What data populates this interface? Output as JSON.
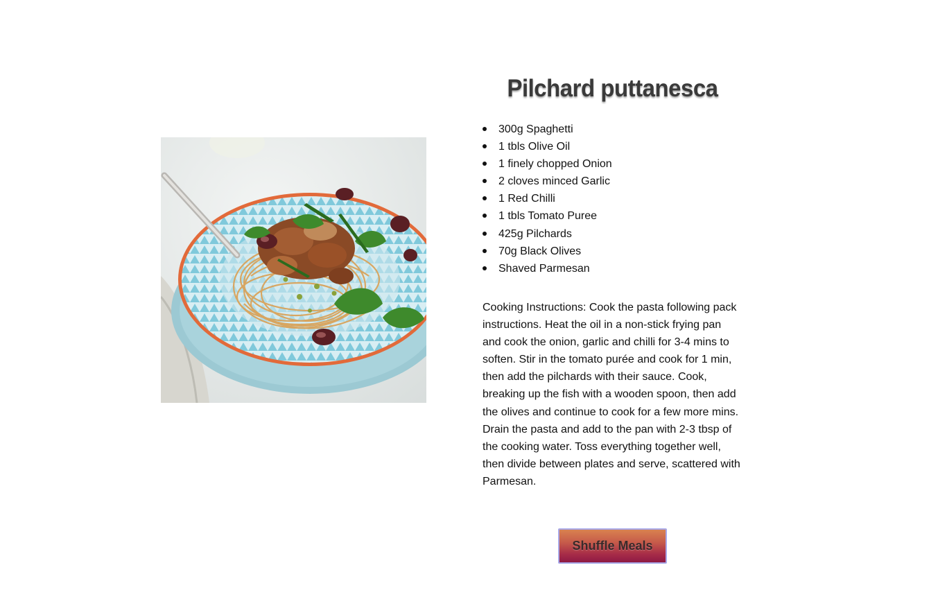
{
  "meal": {
    "title": "Pilchard puttanesca",
    "image_alt": "Pilchard puttanesca",
    "ingredients": [
      "300g Spaghetti",
      "1 tbls Olive Oil",
      "1 finely chopped Onion",
      "2 cloves minced Garlic",
      "1 Red Chilli",
      "1 tbls Tomato Puree",
      "425g Pilchards",
      "70g Black Olives",
      "Shaved Parmesan"
    ],
    "instructions": "Cooking Instructions: Cook the pasta following pack instructions. Heat the oil in a non-stick frying pan and cook the onion, garlic and chilli for 3-4 mins to soften. Stir in the tomato purée and cook for 1 min, then add the pilchards with their sauce. Cook, breaking up the fish with a wooden spoon, then add the olives and continue to cook for a few more mins. Drain the pasta and add to the pan with 2-3 tbsp of the cooking water. Toss everything together well, then divide between plates and serve, scattered with Parmesan."
  },
  "controls": {
    "shuffle_label": "Shuffle Meals"
  },
  "colors": {
    "button_gradient_top": "#d9824f",
    "button_gradient_bottom": "#8e1a44",
    "button_border": "#a8a8e8",
    "plate_blue": "#8ecfdc"
  }
}
